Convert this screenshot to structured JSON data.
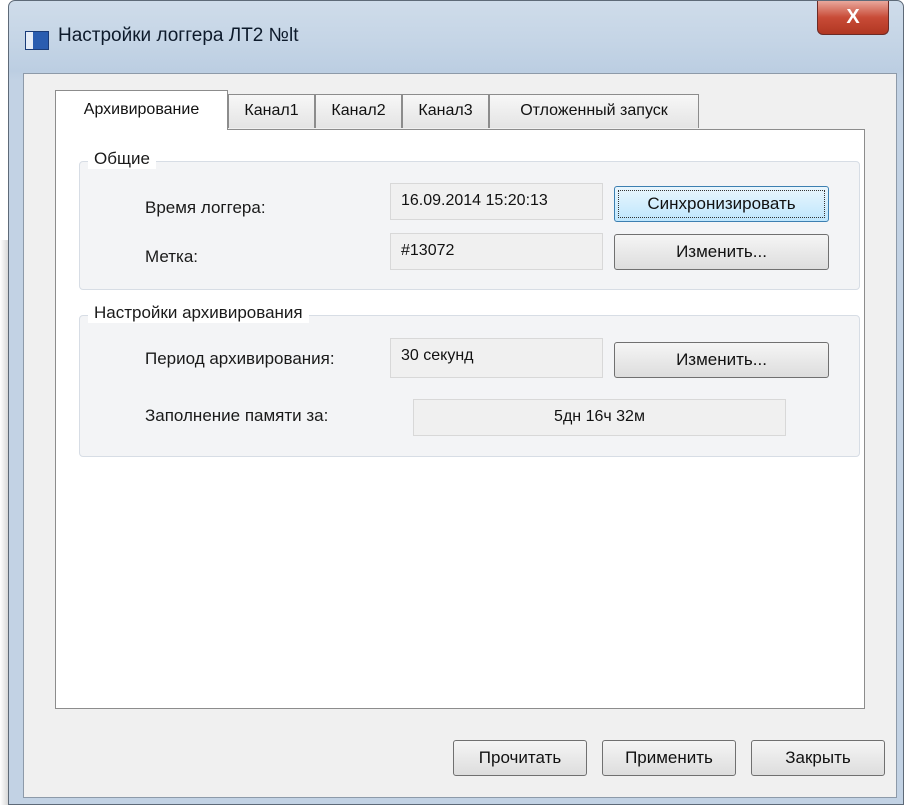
{
  "window": {
    "title": "Настройки логгера ЛТ2 №lt",
    "close_glyph": "X"
  },
  "tabs": [
    {
      "label": "Архивирование",
      "active": true
    },
    {
      "label": "Канал1",
      "active": false
    },
    {
      "label": "Канал2",
      "active": false
    },
    {
      "label": "Канал3",
      "active": false
    },
    {
      "label": "Отложенный запуск",
      "active": false
    }
  ],
  "general": {
    "title": "Общие",
    "logger_time_label": "Время логгера:",
    "logger_time_value": "16.09.2014 15:20:13",
    "sync_button": "Синхронизировать",
    "tag_label": "Метка:",
    "tag_value": "#13072",
    "tag_change_button": "Изменить..."
  },
  "archiving": {
    "title": "Настройки архивирования",
    "period_label": "Период архивирования:",
    "period_value": "30 секунд",
    "period_change_button": "Изменить...",
    "fill_label": "Заполнение памяти за:",
    "fill_value": "5дн 16ч 32м"
  },
  "footer": {
    "read_button": "Прочитать",
    "apply_button": "Применить",
    "close_button": "Закрыть"
  }
}
